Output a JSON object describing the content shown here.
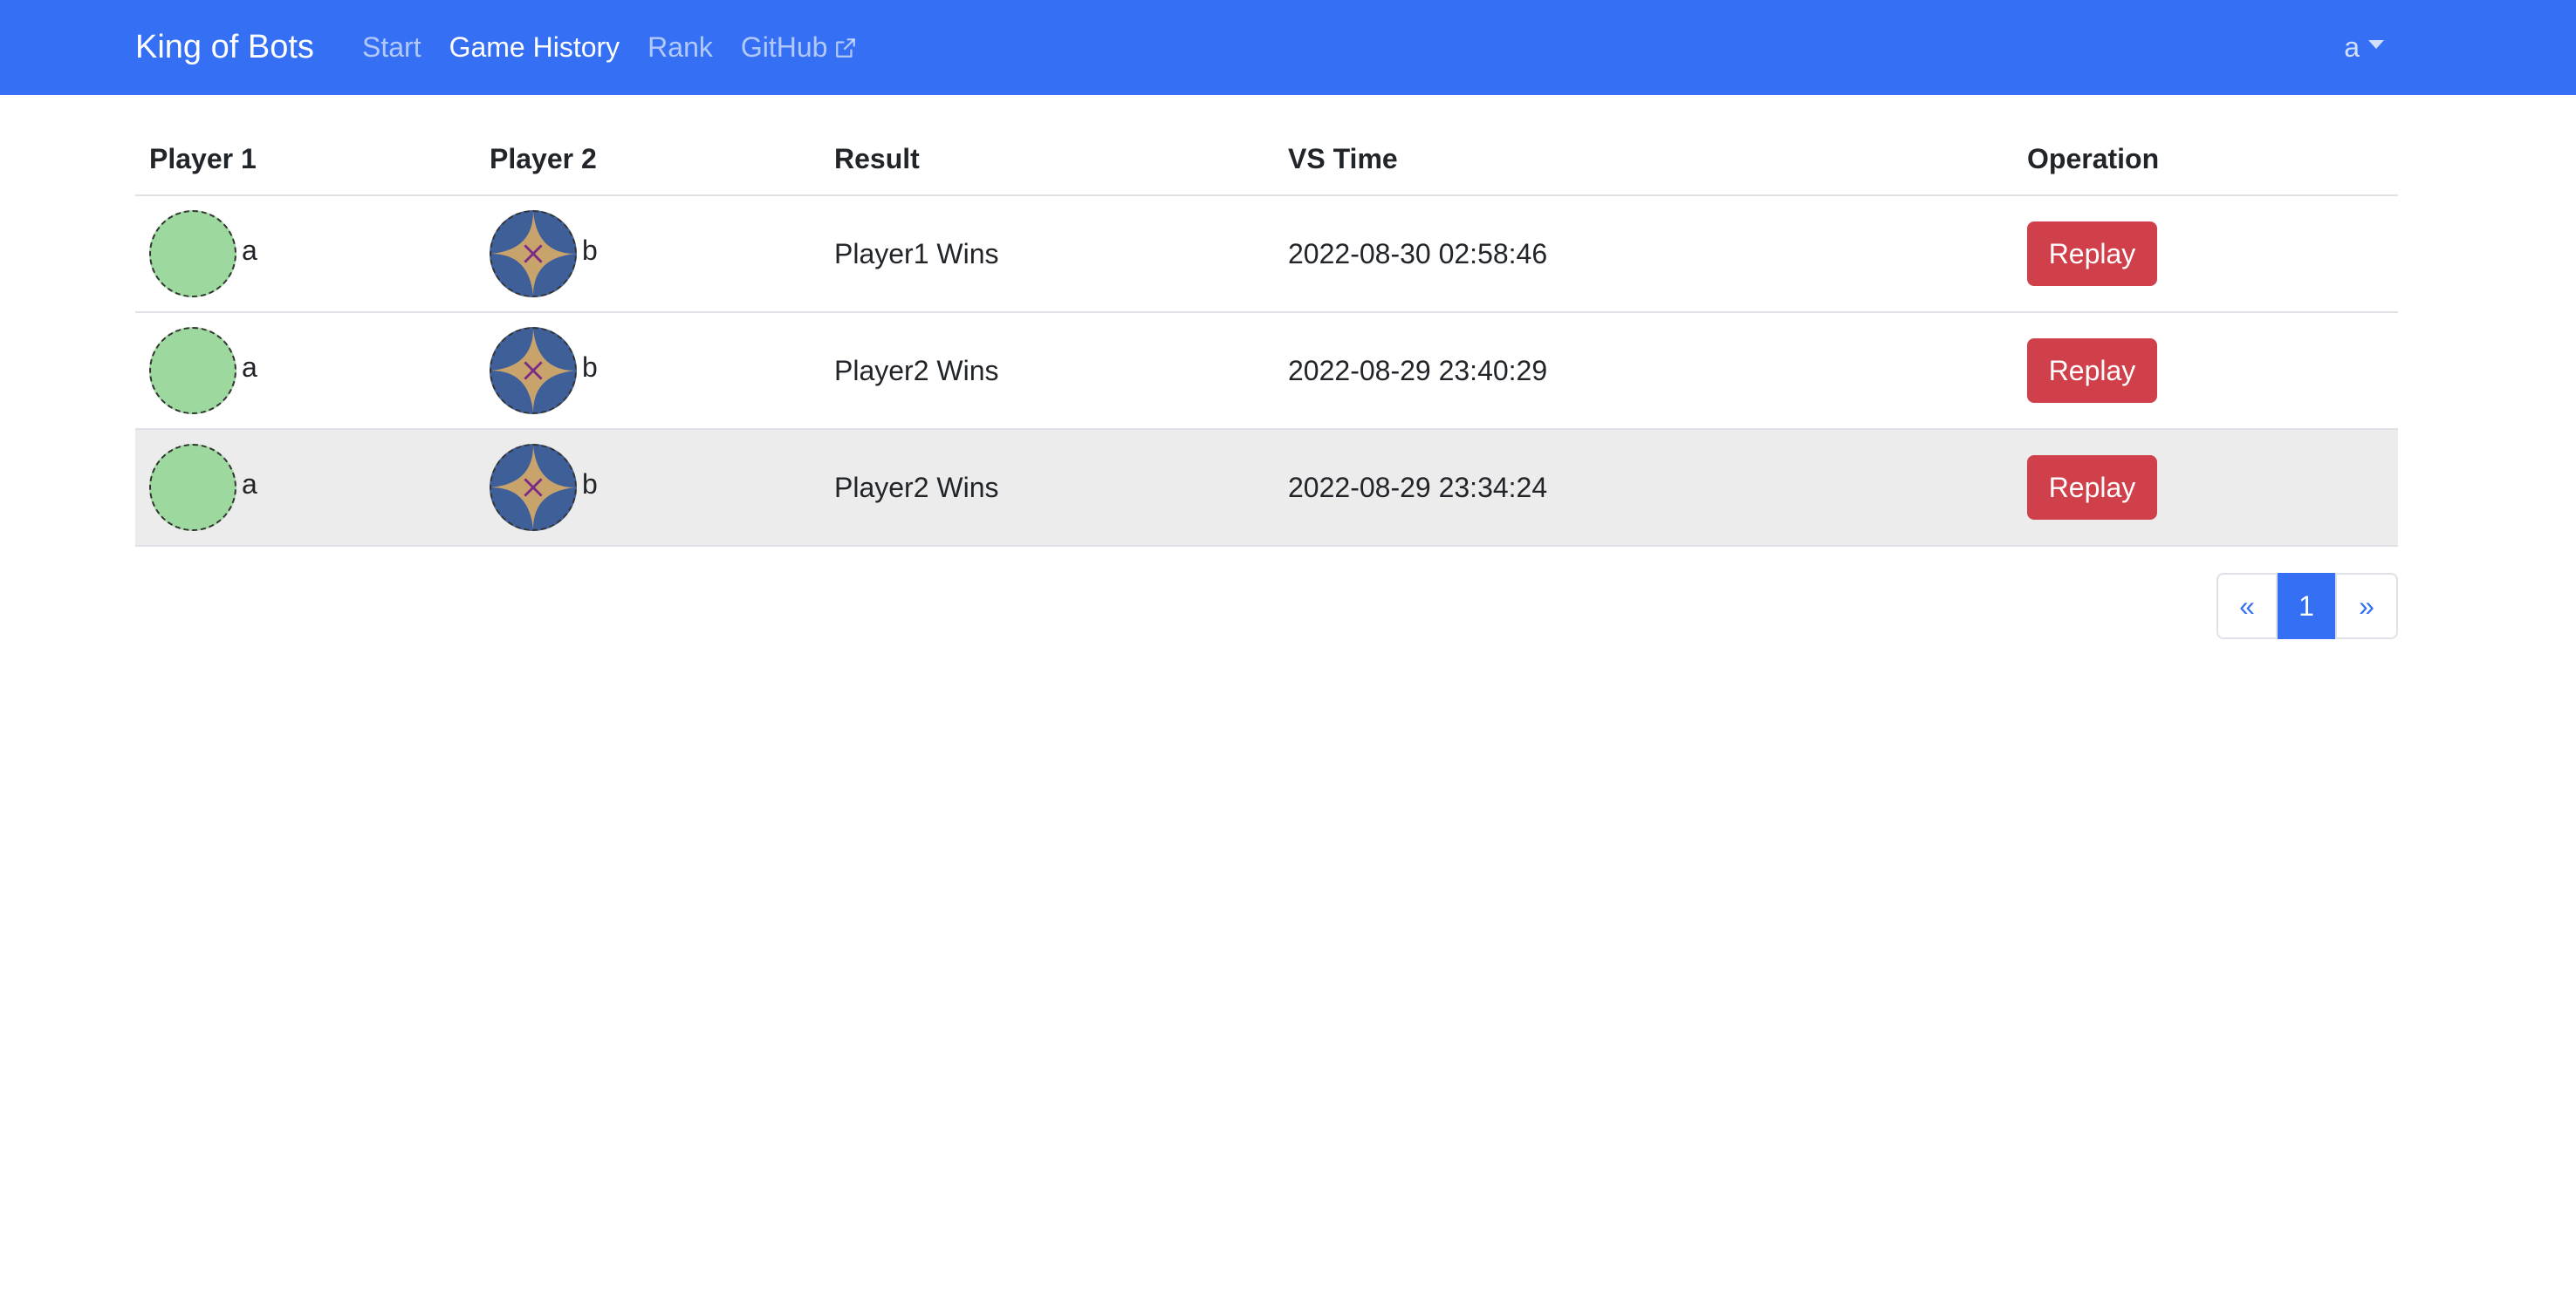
{
  "navbar": {
    "brand": "King of Bots",
    "links": [
      {
        "label": "Start",
        "active": false
      },
      {
        "label": "Game History",
        "active": true
      },
      {
        "label": "Rank",
        "active": false
      },
      {
        "label": "GitHub",
        "active": false
      }
    ],
    "user": "a"
  },
  "table": {
    "headers": [
      "Player 1",
      "Player 2",
      "Result",
      "VS Time",
      "Operation"
    ],
    "rows": [
      {
        "player1": "a",
        "player2": "b",
        "result": "Player1 Wins",
        "time": "2022-08-30 02:58:46",
        "action": "Replay"
      },
      {
        "player1": "a",
        "player2": "b",
        "result": "Player2 Wins",
        "time": "2022-08-29 23:40:29",
        "action": "Replay"
      },
      {
        "player1": "a",
        "player2": "b",
        "result": "Player2 Wins",
        "time": "2022-08-29 23:34:24",
        "action": "Replay"
      }
    ]
  },
  "pagination": {
    "prev": "«",
    "current": "1",
    "next": "»"
  },
  "colors": {
    "navbar": "#346ff4",
    "replay_button": "#d0404b",
    "avatar_player1": "#9dd99f",
    "avatar_player2": "#3f5f99"
  }
}
